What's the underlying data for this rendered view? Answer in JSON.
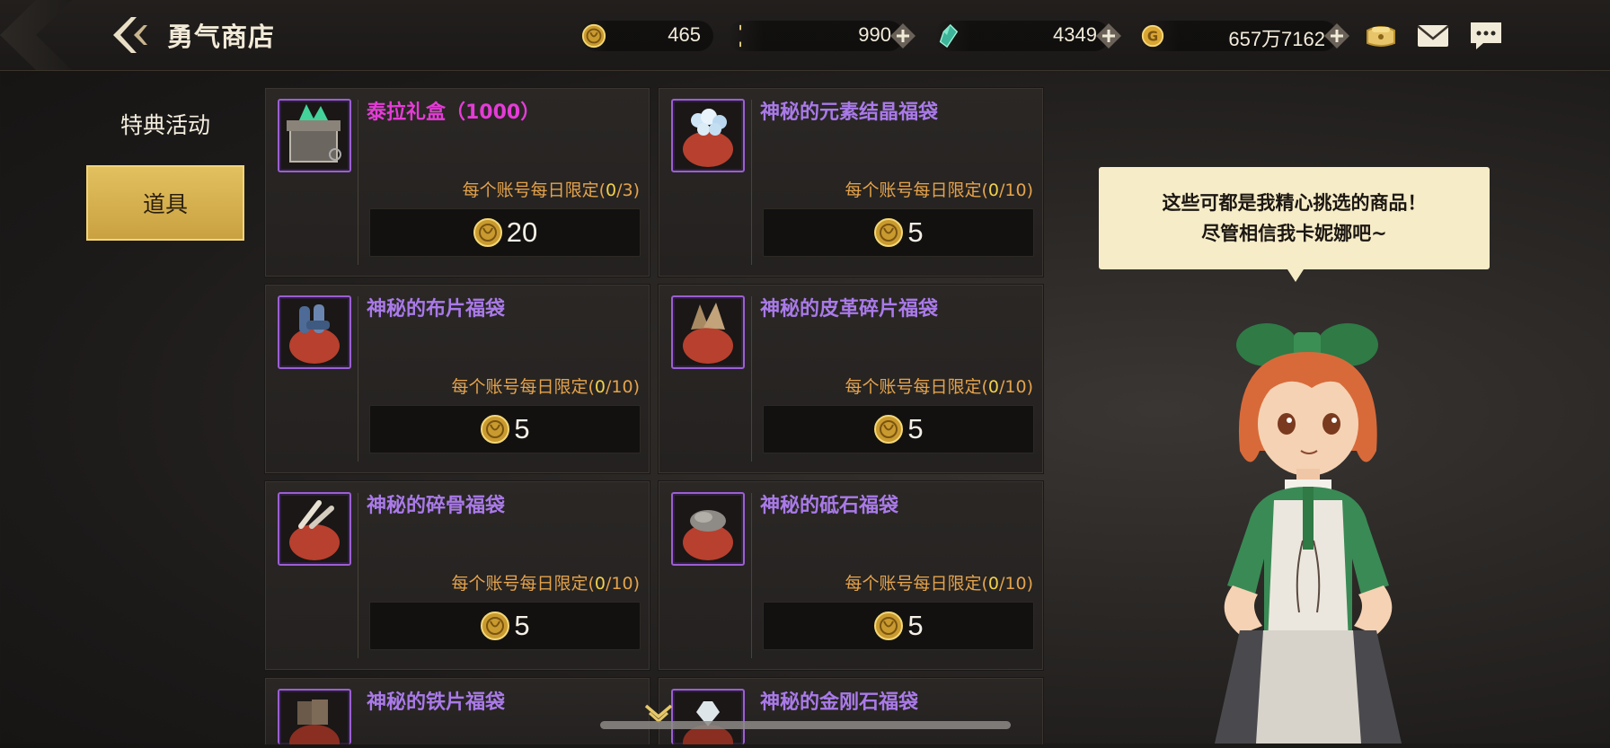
{
  "header": {
    "title": "勇气商店",
    "currencies": [
      {
        "icon": "courage-coin-icon",
        "value": "465",
        "has_plus": false
      },
      {
        "icon": "crescent-token-icon",
        "value": "990",
        "has_plus": true
      },
      {
        "icon": "tera-crystal-icon",
        "value": "4349",
        "has_plus": true
      },
      {
        "icon": "gold-coin-icon",
        "value": "657万7162",
        "has_plus": true
      }
    ],
    "right_icons": [
      "coin-pouch-icon",
      "mail-icon",
      "chat-icon"
    ]
  },
  "sidebar": {
    "items": [
      {
        "label": "特典活动",
        "active": false
      },
      {
        "label": "道具",
        "active": true
      }
    ]
  },
  "shop": {
    "items": [
      {
        "name": "泰拉礼盒（1000）",
        "limit_prefix": "每个账号每日限定(",
        "limit_used": "0",
        "limit_total": "/3)",
        "price": "20",
        "icon": "tera-gift-box-icon"
      },
      {
        "name": "神秘的元素结晶福袋",
        "limit_prefix": "每个账号每日限定(",
        "limit_used": "0",
        "limit_total": "/10)",
        "price": "5",
        "icon": "element-crystal-bag-icon"
      },
      {
        "name": "神秘的布片福袋",
        "limit_prefix": "每个账号每日限定(",
        "limit_used": "0",
        "limit_total": "/10)",
        "price": "5",
        "icon": "cloth-bag-icon"
      },
      {
        "name": "神秘的皮革碎片福袋",
        "limit_prefix": "每个账号每日限定(",
        "limit_used": "0",
        "limit_total": "/10)",
        "price": "5",
        "icon": "leather-bag-icon"
      },
      {
        "name": "神秘的碎骨福袋",
        "limit_prefix": "每个账号每日限定(",
        "limit_used": "0",
        "limit_total": "/10)",
        "price": "5",
        "icon": "bone-bag-icon"
      },
      {
        "name": "神秘的砥石福袋",
        "limit_prefix": "每个账号每日限定(",
        "limit_used": "0",
        "limit_total": "/10)",
        "price": "5",
        "icon": "whetstone-bag-icon"
      },
      {
        "name": "神秘的铁片福袋",
        "icon": "iron-bag-icon"
      },
      {
        "name": "神秘的金刚石福袋",
        "icon": "diamond-bag-icon"
      }
    ]
  },
  "npc": {
    "speech_line1": "这些可都是我精心挑选的商品！",
    "speech_line2": "尽管相信我卡妮娜吧~"
  },
  "colors": {
    "item_name": "#a97ae8",
    "item_name_special": "#e43cd6",
    "limit_text": "#e4a34c",
    "active_tab": "#d9b24f",
    "speech_bg": "#f6ecc8"
  }
}
